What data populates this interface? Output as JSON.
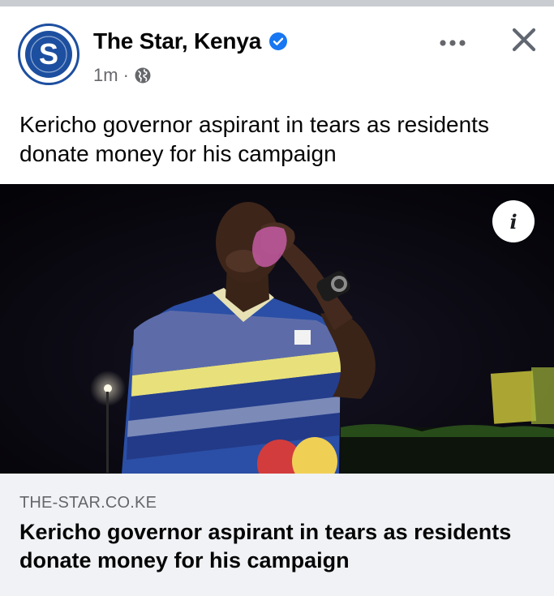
{
  "post": {
    "page_name": "The Star, Kenya",
    "avatar_letter": "S",
    "timestamp": "1m",
    "separator": "·",
    "caption": "Kericho governor aspirant in tears as residents donate money for his campaign",
    "icons": {
      "verified": "verified-badge-icon",
      "audience": "globe-icon",
      "more": "more-options-icon",
      "close": "close-icon",
      "info": "info-icon"
    },
    "info_glyph": "i"
  },
  "link_preview": {
    "domain": "THE-STAR.CO.KE",
    "title": "Kericho governor aspirant in tears as residents donate money for his campaign"
  },
  "colors": {
    "brand_blue": "#1d4fa0",
    "verified_blue": "#1877f2",
    "secondary_text": "#65676b",
    "preview_bg": "#f0f2f5"
  }
}
